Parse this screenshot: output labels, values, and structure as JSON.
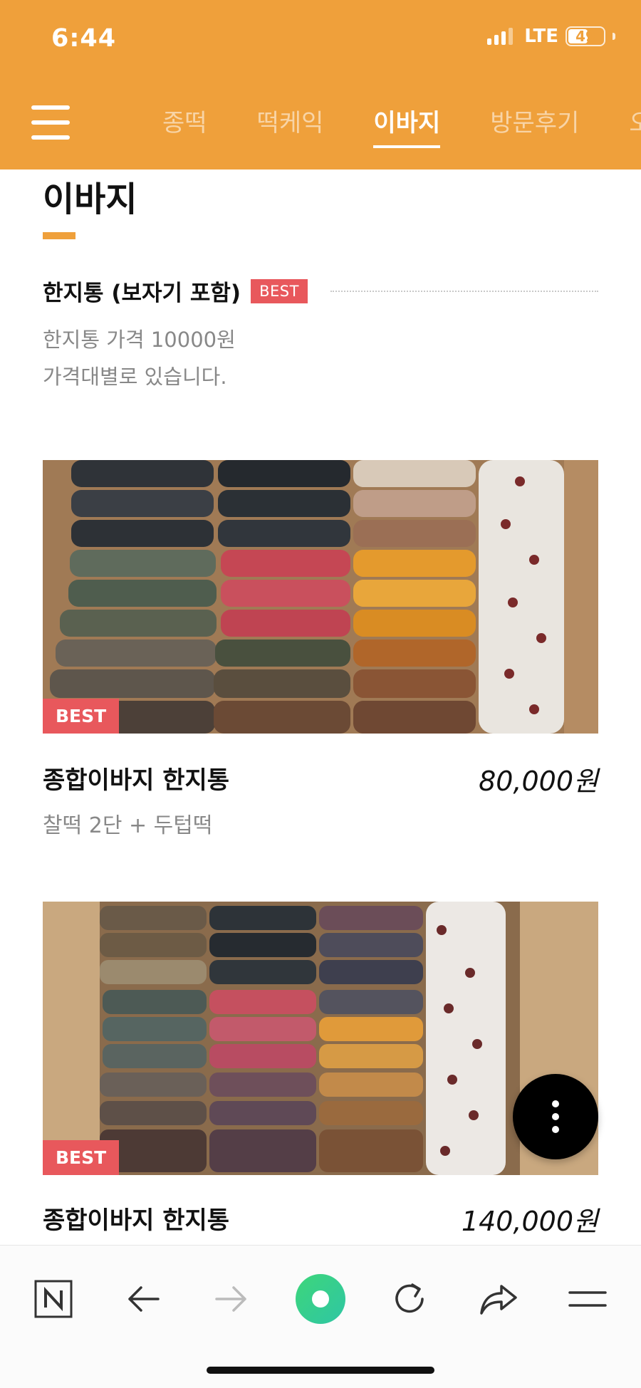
{
  "status_bar": {
    "time": "6:44",
    "network": "LTE",
    "battery": "49"
  },
  "nav": {
    "tabs": [
      {
        "label": "종떡",
        "active": false
      },
      {
        "label": "떡케익",
        "active": false
      },
      {
        "label": "이바지",
        "active": true
      },
      {
        "label": "방문후기",
        "active": false
      },
      {
        "label": "오",
        "active": false
      }
    ]
  },
  "section": {
    "title": "이바지",
    "group_name": "한지통 (보자기 포함)",
    "group_badge": "BEST",
    "desc_lines": [
      "한지통 가격 10000원",
      "가격대별로 있습니다."
    ]
  },
  "products": [
    {
      "badge": "BEST",
      "name": "종합이바지 한지통",
      "price": "80,000원",
      "sub": "찰떡 2단 + 두텁떡"
    },
    {
      "badge": "BEST",
      "name": "종합이바지 한지통",
      "price": "140,000원"
    }
  ],
  "colors": {
    "accent": "#EFA03B",
    "badge": "#E8585C"
  },
  "icons": [
    "menu-icon",
    "naver-icon",
    "back-arrow-icon",
    "forward-arrow-icon",
    "green-dot-icon",
    "refresh-icon",
    "share-icon",
    "menu-lines-icon",
    "more-vertical-icon"
  ]
}
